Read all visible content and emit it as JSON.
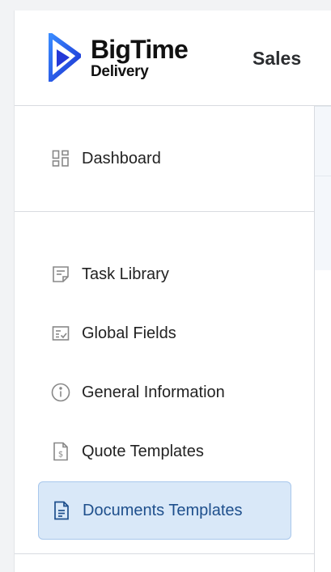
{
  "brand": {
    "name_line1": "BigTime",
    "name_line2": "Delivery"
  },
  "header": {
    "section_title": "Sales"
  },
  "sidebar": {
    "items": [
      {
        "label": "Dashboard",
        "icon": "dashboard-icon",
        "active": false
      },
      {
        "label": "Task Library",
        "icon": "task-library-icon",
        "active": false
      },
      {
        "label": "Global Fields",
        "icon": "global-fields-icon",
        "active": false
      },
      {
        "label": "General Information",
        "icon": "info-icon",
        "active": false
      },
      {
        "label": "Quote Templates",
        "icon": "quote-document-icon",
        "active": false
      },
      {
        "label": "Documents Templates",
        "icon": "document-icon",
        "active": true
      }
    ]
  },
  "colors": {
    "accent": "#1e4f8c",
    "active_bg": "#d9e8f8",
    "brand_blue": "#2f54e8"
  }
}
